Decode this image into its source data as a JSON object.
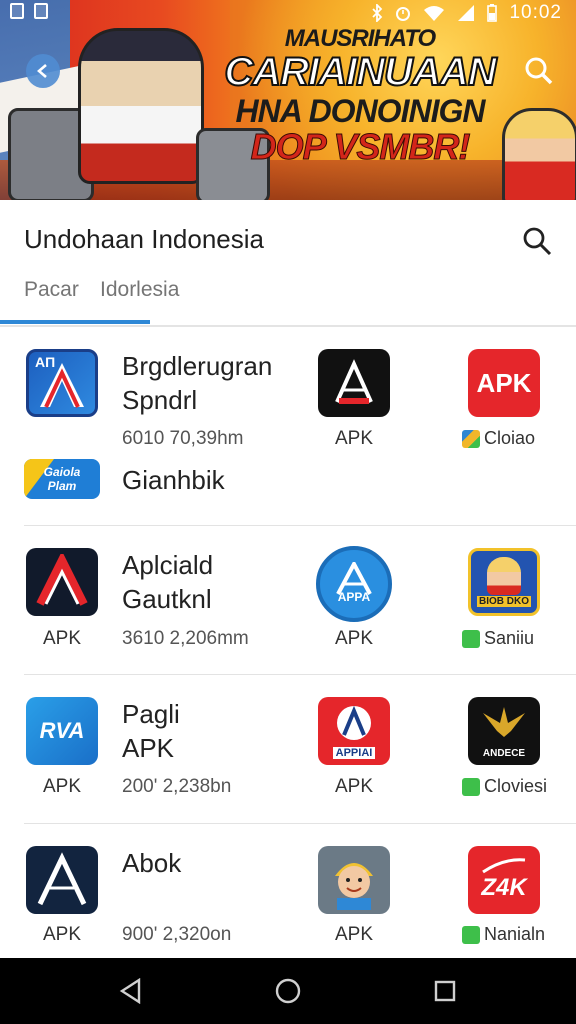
{
  "status_bar": {
    "time": "10:02"
  },
  "banner": {
    "line1": "MAUSRIHATO",
    "line2": "CARIAINUAAN",
    "line3": "HNA DONOINIGN",
    "line4": "DOP VSMBR!"
  },
  "header": {
    "title": "Undohaan Indonesia",
    "tabs": [
      {
        "label": "Pacar"
      },
      {
        "label": "Idorlesia"
      }
    ]
  },
  "rows": [
    {
      "name": "Brgdlerugran\nSpndrl",
      "meta": "6010 70,39hm",
      "app2_label": "APK",
      "app3_tag": "Cloiao",
      "icon1_text": "AП",
      "icon3_text": "APK",
      "extra": {
        "badge_line1": "Gaiola",
        "badge_line2": "Plam",
        "name": "Gianhbik"
      }
    },
    {
      "name": "Aplciald\nGautknl",
      "meta": "3610 2,206mm",
      "app1_label": "APK",
      "app2_label": "APK",
      "app2_icon_text": "APPA",
      "app3_icon_text": "BIOB DKO",
      "app3_tag": "Saniiu"
    },
    {
      "name": "Pagli\nAPK",
      "meta": "200' 2,238bn",
      "app1_label": "APK",
      "app1_icon_text": "RVA",
      "app2_label": "APK",
      "app2_icon_text": "APPIAI",
      "app3_icon_text": "ANDECE",
      "app3_tag": "Cloviesi"
    },
    {
      "name": "Abok",
      "meta": "900' 2,320on",
      "app1_label": "APK",
      "app2_label": "APK",
      "app3_icon_text": "Z4K",
      "app3_tag": "Nanialn"
    }
  ],
  "colors": {
    "accent": "#2e88d6",
    "tag_green": "#3ebf4a",
    "apk_red": "#e5262b"
  }
}
